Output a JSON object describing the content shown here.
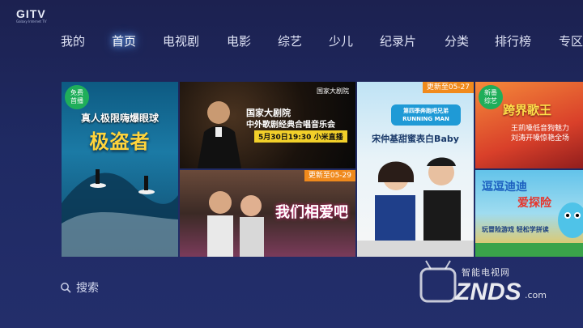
{
  "logo": {
    "main": "GITV",
    "sub": "Galaxy Internet TV"
  },
  "nav": {
    "items": [
      "我的",
      "首页",
      "电视剧",
      "电影",
      "综艺",
      "少儿",
      "纪录片",
      "分类",
      "排行榜",
      "专区"
    ],
    "active_index": 1
  },
  "tiles": {
    "t1": {
      "badge": "免费\n首播",
      "subtitle": "真人极限嗨爆眼球",
      "title": "极盗者"
    },
    "t2": {
      "org": "国家大剧院",
      "title1": "国家大剧院",
      "title2": "中外歌剧经典合唱音乐会",
      "time": "5月30日19:30 小米直播"
    },
    "t3": {
      "update": "更新至05-29",
      "title": "我们相爱吧"
    },
    "t4": {
      "update": "更新至05-27",
      "logo": "第四季奔跑吧兄弟 RUNNING MAN",
      "text": "宋仲基甜蜜表白Baby"
    },
    "t5": {
      "badge": "新番\n综艺",
      "title": "跨界歌王",
      "sub1": "王凯嗓低音狗魅力",
      "sub2": "刘涛开嗓惊艳全场"
    },
    "t6": {
      "title1": "逗逗迪迪",
      "title2": "爱探险",
      "sub": "玩冒险游戏  轻松学拼读"
    }
  },
  "search": {
    "label": "搜索",
    "icon": "search-icon"
  },
  "watermark": {
    "text": "智能电视网",
    "brand": "ZNDS",
    "suffix": ".com"
  },
  "colors": {
    "background": "#1f2a63",
    "update_badge": "#f08a1c",
    "free_badge": "#1fae5a"
  }
}
